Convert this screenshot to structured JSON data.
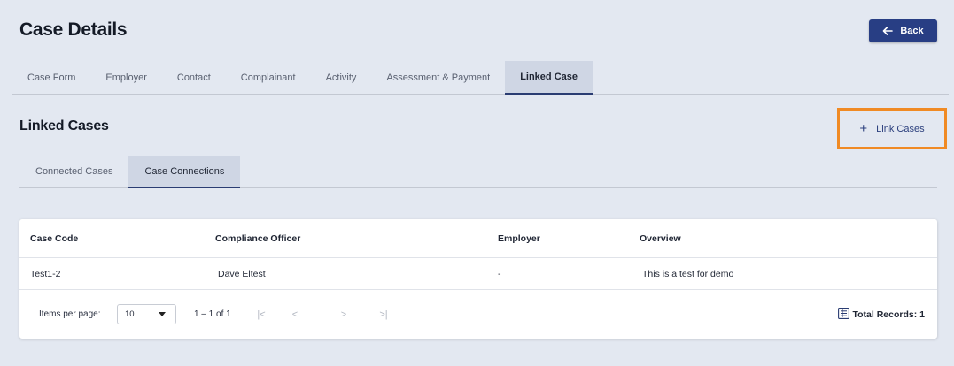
{
  "header": {
    "title": "Case Details",
    "back_label": "Back"
  },
  "main_tabs": [
    {
      "label": "Case Form",
      "active": false
    },
    {
      "label": "Employer",
      "active": false
    },
    {
      "label": "Contact",
      "active": false
    },
    {
      "label": "Complainant",
      "active": false
    },
    {
      "label": "Activity",
      "active": false
    },
    {
      "label": "Assessment & Payment",
      "active": false
    },
    {
      "label": "Linked Case",
      "active": true
    }
  ],
  "section": {
    "title": "Linked Cases",
    "link_button_label": "Link Cases",
    "link_button_icon": "+"
  },
  "sub_tabs": [
    {
      "label": "Connected Cases",
      "active": false
    },
    {
      "label": "Case Connections",
      "active": true
    }
  ],
  "table": {
    "columns": [
      "Case Code",
      "Compliance Officer",
      "Employer",
      "Overview"
    ],
    "rows": [
      [
        "Test1-2",
        "Dave Eltest",
        "-",
        "This is a test for demo"
      ]
    ]
  },
  "paginator": {
    "items_per_page_label": "Items per page:",
    "items_per_page_value": "10",
    "range_label": "1 – 1 of 1",
    "nav_first": "|<",
    "nav_prev": "<",
    "nav_next": ">",
    "nav_last": ">|"
  },
  "total_records_label": "Total Records: 1",
  "colors": {
    "background": "#e3e8f1",
    "primary": "#283e84",
    "active_tab_bg": "#cfd6e4",
    "highlight_border": "#f08a24"
  },
  "icons": {
    "back": "arrow-left-icon",
    "link": "plus-icon",
    "select": "caret-down-icon",
    "total": "list-icon"
  }
}
